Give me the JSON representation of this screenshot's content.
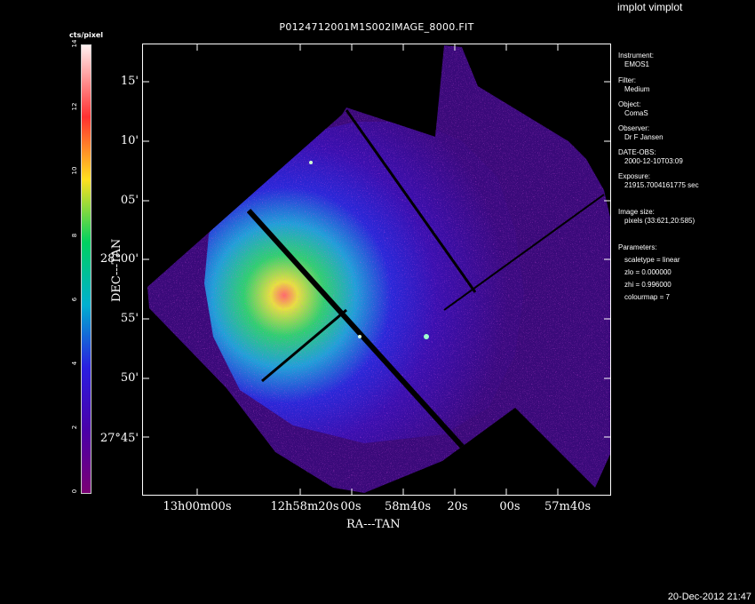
{
  "program_title": "implot vimplot",
  "figure_title": "P0124712001M1S002IMAGE_8000.FIT",
  "colorbar": {
    "label": "cts/pixel",
    "ticks": [
      "0",
      "2",
      "4",
      "6",
      "8",
      "10",
      "12",
      "14"
    ],
    "range": [
      0,
      14
    ]
  },
  "y_axis": {
    "title": "DEC---TAN",
    "ticks": [
      "15'",
      "10'",
      "05'",
      "28°00'",
      "55'",
      "50'",
      "27°45'"
    ]
  },
  "x_axis": {
    "title": "RA---TAN",
    "ticks": [
      "13h00m00s",
      "12h58m20s",
      "00s",
      "58m40s",
      "20s",
      "00s",
      "57m40s"
    ]
  },
  "metadata": [
    {
      "key": "Instrument:",
      "value": "EMOS1"
    },
    {
      "key": "Filter:",
      "value": "Medium"
    },
    {
      "key": "Object:",
      "value": "ComaS"
    },
    {
      "key": "Observer:",
      "value": "Dr F Jansen"
    },
    {
      "key": "DATE-OBS:",
      "value": "2000-12-10T03:09"
    },
    {
      "key": "Exposure:",
      "value": "21915.7004161775 sec"
    },
    {
      "key": "Image size:",
      "value": "pixels (33:621,20:585)"
    },
    {
      "key": "Parameters:",
      "value": [
        "scaletype = linear",
        "zlo = 0.000000",
        "zhi = 0.996000",
        "colourmap =   7"
      ]
    }
  ],
  "timestamp": "20-Dec-2012 21:47",
  "colors": {
    "background": "#000000",
    "foreground": "#ffffff",
    "low": "#7a0074",
    "mid": "#2a1ee0",
    "high": "#ffe020"
  },
  "chart_data": {
    "type": "heatmap",
    "title": "P0124712001M1S002IMAGE_8000.FIT",
    "xlabel": "RA---TAN",
    "ylabel": "DEC---TAN",
    "colorbar_label": "cts/pixel",
    "zrange": [
      0,
      14
    ],
    "scale": "linear"
  }
}
